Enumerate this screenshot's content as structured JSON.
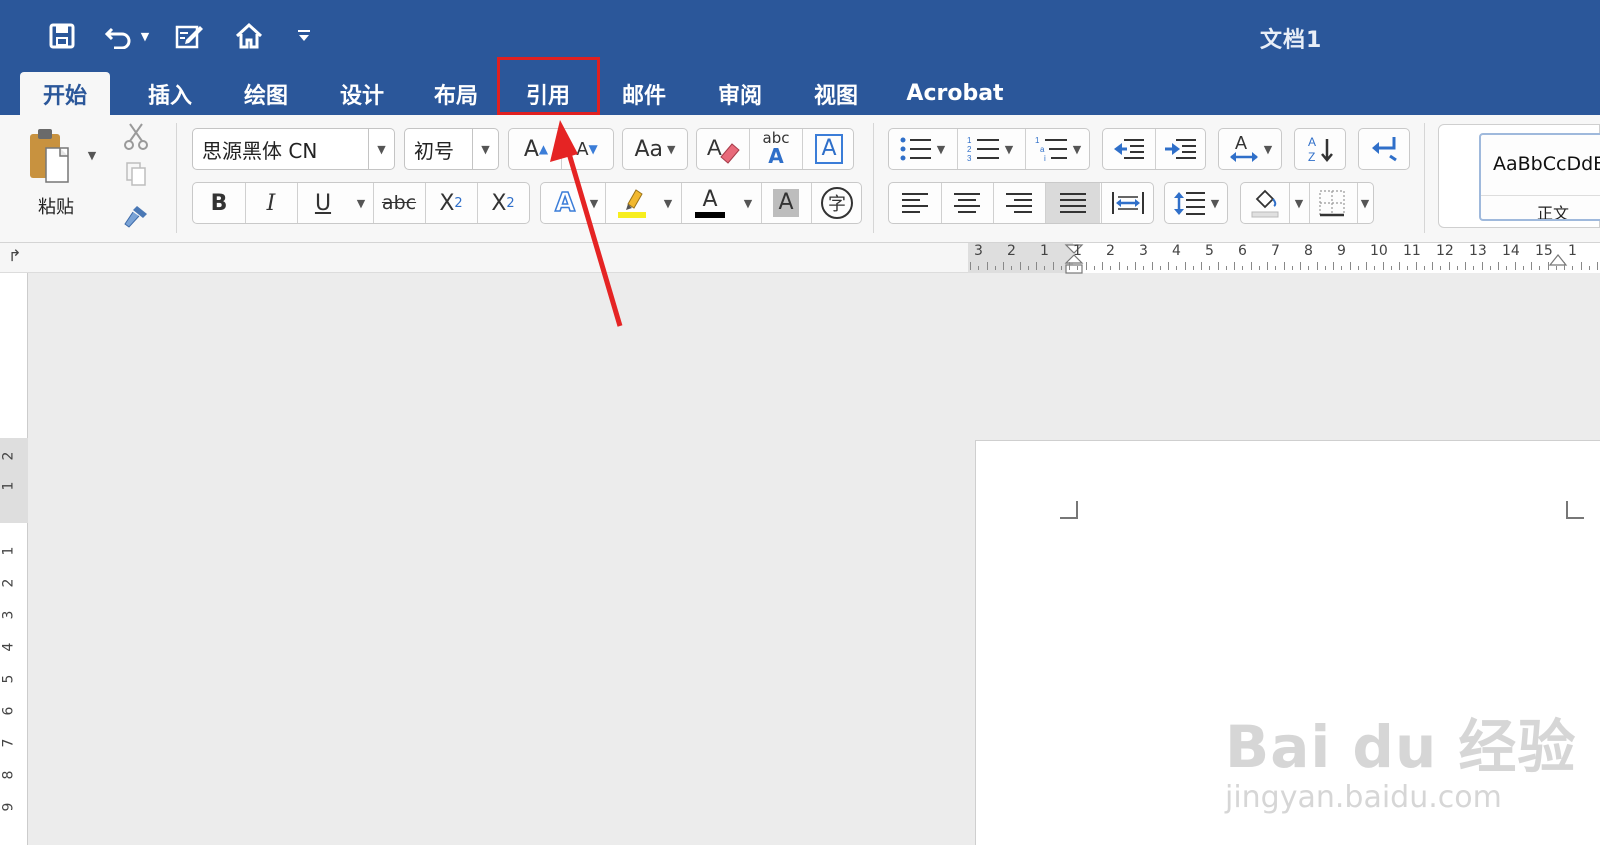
{
  "title_bar": {
    "document_title": "文档1",
    "quick_access": [
      {
        "name": "save-icon",
        "glyph": "💾"
      },
      {
        "name": "undo-icon",
        "glyph": "↶"
      },
      {
        "name": "edit-icon",
        "glyph": "✎"
      },
      {
        "name": "home-icon",
        "glyph": "⌂"
      },
      {
        "name": "customize-icon",
        "glyph": "▾"
      }
    ],
    "bg_color": "#2b579a"
  },
  "tabs": [
    {
      "label": "开始",
      "active": true
    },
    {
      "label": "插入"
    },
    {
      "label": "绘图"
    },
    {
      "label": "设计"
    },
    {
      "label": "布局"
    },
    {
      "label": "引用",
      "highlighted": true
    },
    {
      "label": "邮件"
    },
    {
      "label": "审阅"
    },
    {
      "label": "视图"
    },
    {
      "label": "Acrobat"
    }
  ],
  "ribbon": {
    "clipboard": {
      "paste_label": "粘贴"
    },
    "font": {
      "family": "思源黑体 CN",
      "size": "初号",
      "grow_label": "A",
      "shrink_label": "A",
      "change_case_label": "Aa",
      "bold": "B",
      "italic": "I",
      "underline": "U",
      "strike": "abc",
      "subscript": "X",
      "subscript_mark": "2",
      "superscript": "X",
      "superscript_mark": "2",
      "text_effects": "A",
      "font_color": "A",
      "char_shading": "A",
      "enclose_char": "字",
      "phonetic_label": "abc",
      "border_char": "A",
      "clear_format": "A"
    },
    "styles": {
      "preview": "AaBbCcDdE",
      "name": "正文"
    }
  },
  "ruler": {
    "h_numbers": [
      "3",
      "2",
      "1",
      "1",
      "2",
      "3",
      "4",
      "5",
      "6",
      "7",
      "8",
      "9",
      "10",
      "11",
      "12",
      "13",
      "14",
      "15",
      "1"
    ],
    "v_numbers": [
      "2",
      "1",
      "1",
      "2",
      "3",
      "4",
      "5",
      "6",
      "7",
      "8",
      "9"
    ]
  },
  "watermark": {
    "logo": "Bai du 经验",
    "url": "jingyan.baidu.com"
  }
}
